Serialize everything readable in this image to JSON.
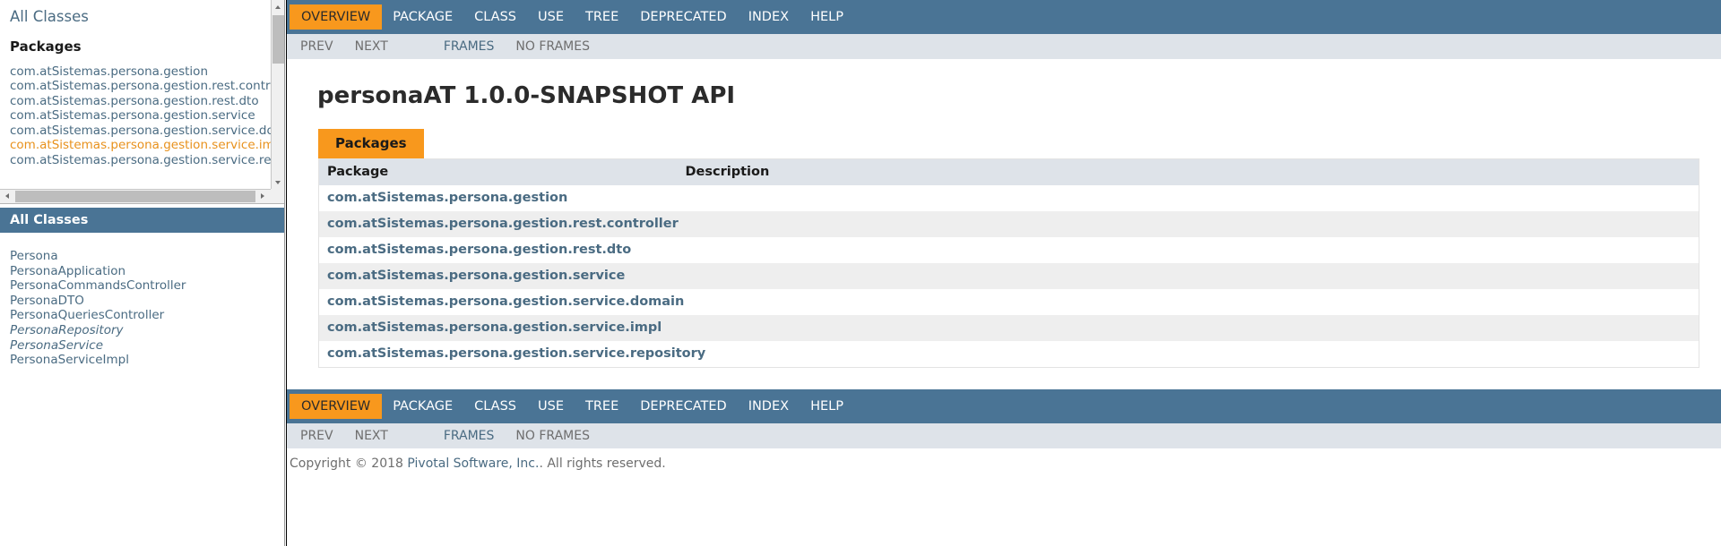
{
  "left_frame": {
    "all_classes_link": "All Classes",
    "packages_heading": "Packages",
    "packages": [
      {
        "label": "com.atSistemas.persona.gestion",
        "active": false
      },
      {
        "label": "com.atSistemas.persona.gestion.rest.controller",
        "active": false
      },
      {
        "label": "com.atSistemas.persona.gestion.rest.dto",
        "active": false
      },
      {
        "label": "com.atSistemas.persona.gestion.service",
        "active": false
      },
      {
        "label": "com.atSistemas.persona.gestion.service.domain",
        "active": false
      },
      {
        "label": "com.atSistemas.persona.gestion.service.impl",
        "active": true
      },
      {
        "label": "com.atSistemas.persona.gestion.service.repository",
        "active": false
      }
    ],
    "all_classes_header": "All Classes",
    "classes": [
      {
        "label": "Persona",
        "interface": false
      },
      {
        "label": "PersonaApplication",
        "interface": false
      },
      {
        "label": "PersonaCommandsController",
        "interface": false
      },
      {
        "label": "PersonaDTO",
        "interface": false
      },
      {
        "label": "PersonaQueriesController",
        "interface": false
      },
      {
        "label": "PersonaRepository",
        "interface": true
      },
      {
        "label": "PersonaService",
        "interface": true
      },
      {
        "label": "PersonaServiceImpl",
        "interface": false
      }
    ]
  },
  "topnav": {
    "items": [
      {
        "label": "OVERVIEW",
        "active": true
      },
      {
        "label": "PACKAGE",
        "active": false
      },
      {
        "label": "CLASS",
        "active": false
      },
      {
        "label": "USE",
        "active": false
      },
      {
        "label": "TREE",
        "active": false
      },
      {
        "label": "DEPRECATED",
        "active": false
      },
      {
        "label": "INDEX",
        "active": false
      },
      {
        "label": "HELP",
        "active": false
      }
    ]
  },
  "subnav": {
    "prev": "PREV",
    "next": "NEXT",
    "frames": "FRAMES",
    "no_frames": "NO FRAMES"
  },
  "main": {
    "title": "personaAT 1.0.0-SNAPSHOT API",
    "caption": "Packages",
    "columns": {
      "package": "Package",
      "description": "Description"
    },
    "rows": [
      {
        "package": "com.atSistemas.persona.gestion",
        "description": ""
      },
      {
        "package": "com.atSistemas.persona.gestion.rest.controller",
        "description": ""
      },
      {
        "package": "com.atSistemas.persona.gestion.rest.dto",
        "description": ""
      },
      {
        "package": "com.atSistemas.persona.gestion.service",
        "description": ""
      },
      {
        "package": "com.atSistemas.persona.gestion.service.domain",
        "description": ""
      },
      {
        "package": "com.atSistemas.persona.gestion.service.impl",
        "description": ""
      },
      {
        "package": "com.atSistemas.persona.gestion.service.repository",
        "description": ""
      }
    ]
  },
  "footer": {
    "prefix": "Copyright © 2018 ",
    "link": "Pivotal Software, Inc.",
    "suffix": ". All rights reserved."
  },
  "colors": {
    "nav_bar": "#4a7495",
    "accent_orange": "#f8981d",
    "link_blue": "#4a6b82",
    "subnav_bg": "#dee3e9",
    "row_alt": "#eeeeee"
  }
}
